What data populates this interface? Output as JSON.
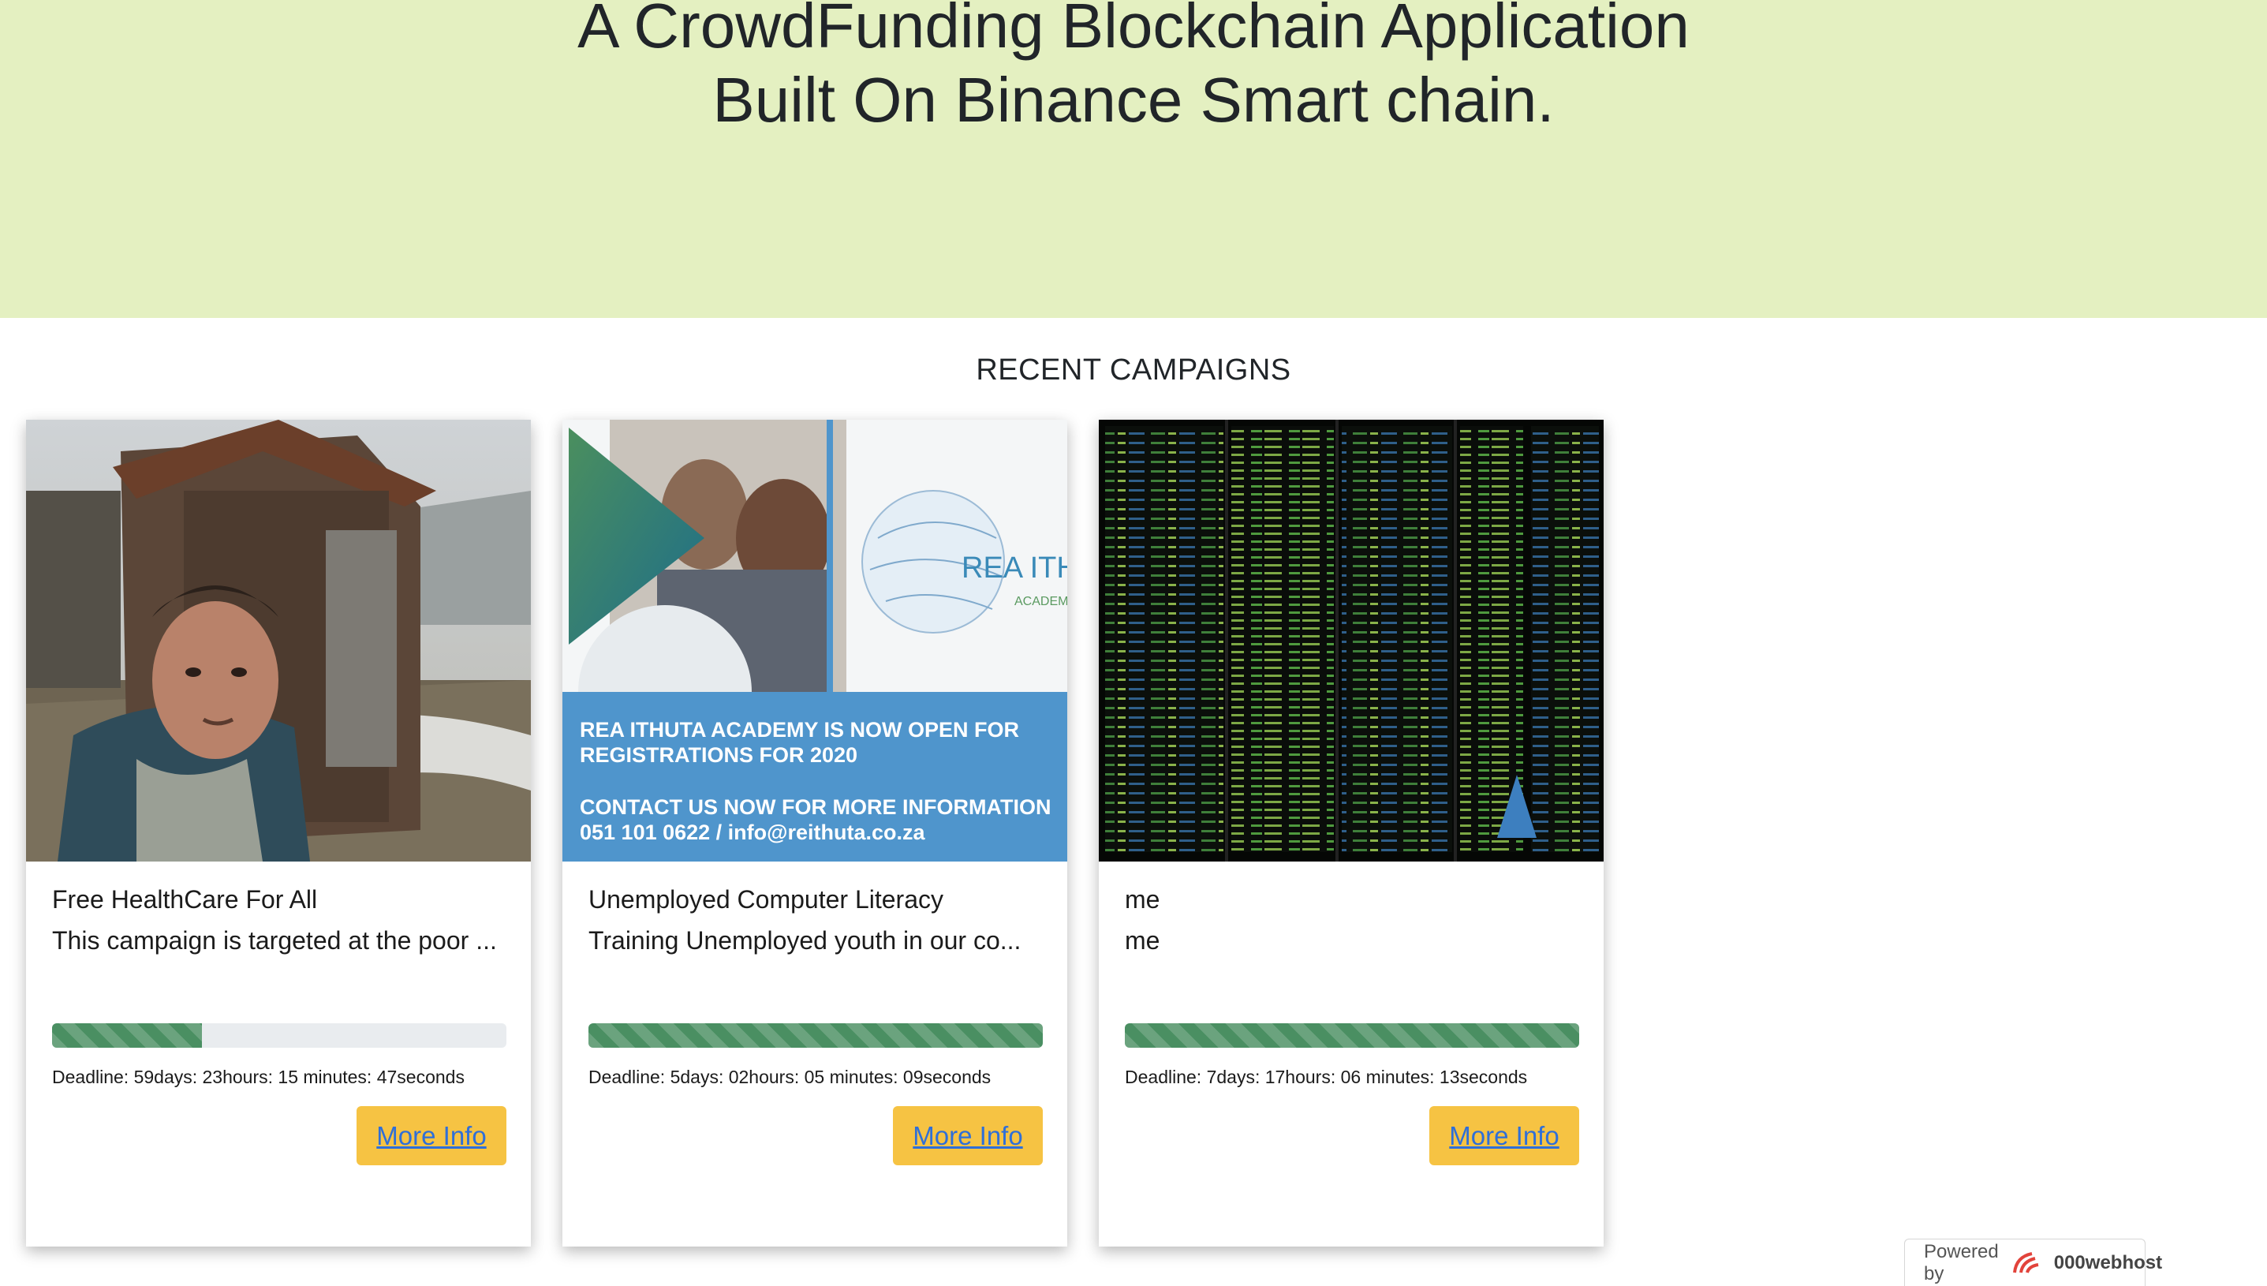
{
  "hero": {
    "line1": "A CrowdFunding Blockchain Application",
    "line2": "Built On Binance Smart chain."
  },
  "section_title": "RECENT CAMPAIGNS",
  "campaigns": [
    {
      "title": "Free HealthCare For All",
      "description": "This campaign is targeted at the poor ...",
      "progress_fraction": 0.33,
      "deadline": "Deadline: 59days: 23hours: 15 minutes: 47seconds",
      "button": "More Info"
    },
    {
      "title": "Unemployed Computer Literacy",
      "description": "Training Unemployed youth in our co...",
      "progress_fraction": 1.0,
      "deadline": "Deadline: 5days: 02hours: 05 minutes: 09seconds",
      "button": "More Info",
      "image_text": {
        "logo_main": "REA ITHUTA",
        "logo_sub": "ACADEMY",
        "line1": "REA ITHUTA ACADEMY IS NOW OPEN FOR",
        "line2": "REGISTRATIONS FOR 2020",
        "line3": "CONTACT US NOW FOR MORE INFORMATION",
        "line4": "051 101 0622 / info@reithuta.co.za"
      }
    },
    {
      "title": "me",
      "description": "me",
      "progress_fraction": 1.0,
      "deadline": "Deadline: 7days: 17hours: 06 minutes: 13seconds",
      "button": "More Info"
    }
  ],
  "footer": {
    "powered_by": "Powered by",
    "brand": "000webhost"
  },
  "colors": {
    "hero_bg": "#e4f0c1",
    "progress": "#4a8f62",
    "button_bg": "#f6c343",
    "link": "#2f6fd8",
    "banner_blue": "#4f95cc"
  }
}
